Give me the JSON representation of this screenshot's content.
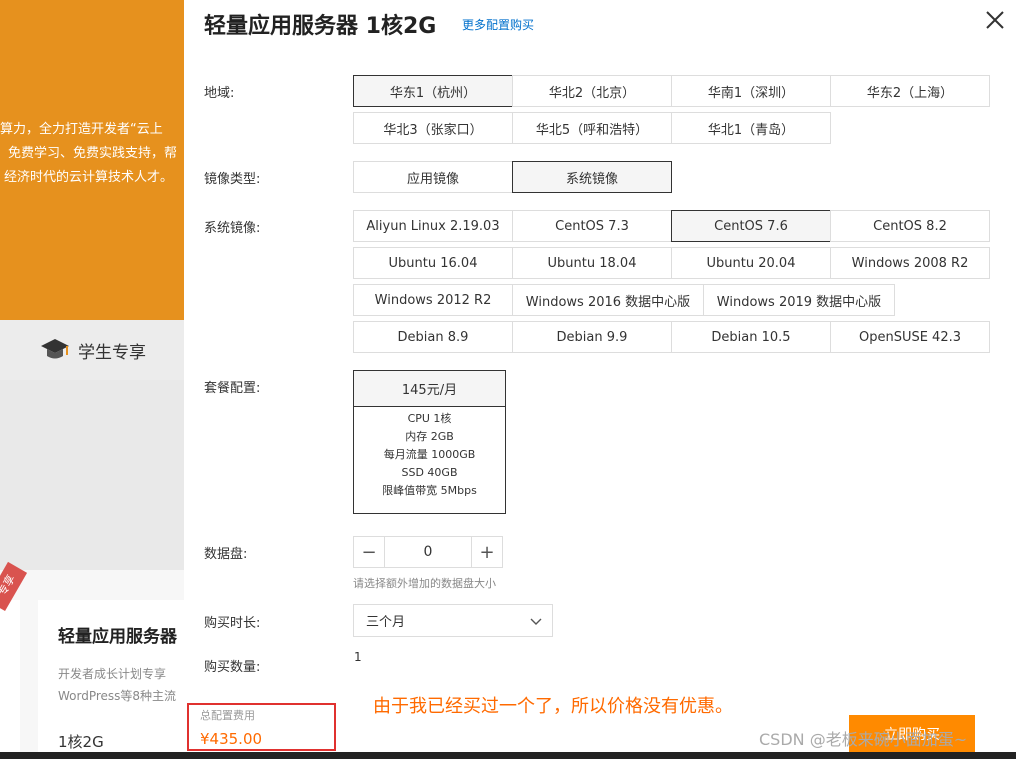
{
  "background": {
    "hero_lines": [
      "算力，全力打造开发者“云上",
      "免费学习、免费实践支持，帮",
      "经济时代的云计算技术人才。"
    ],
    "student_tab": "学生专享",
    "card": {
      "ribbon": "专享",
      "title": "轻量应用服务器",
      "line1": "开发者成长计划专享",
      "line2": "WordPress等8种主流",
      "spec": "1核2G"
    }
  },
  "drawer": {
    "title": "轻量应用服务器 1核2G",
    "more_link": "更多配置购买",
    "labels": {
      "region": "地域:",
      "image_type": "镜像类型:",
      "system_image": "系统镜像:",
      "package": "套餐配置:",
      "data_disk": "数据盘:",
      "duration": "购买时长:",
      "quantity": "购买数量:"
    },
    "regions": [
      "华东1（杭州）",
      "华北2（北京）",
      "华南1（深圳）",
      "华东2（上海）",
      "华北3（张家口）",
      "华北5（呼和浩特）",
      "华北1（青岛）"
    ],
    "selected_region": "华东1（杭州）",
    "image_types": [
      "应用镜像",
      "系统镜像"
    ],
    "selected_image_type": "系统镜像",
    "system_images": [
      "Aliyun Linux 2.19.03",
      "CentOS 7.3",
      "CentOS 7.6",
      "CentOS 8.2",
      "Ubuntu 16.04",
      "Ubuntu 18.04",
      "Ubuntu 20.04",
      "Windows 2008 R2",
      "Windows 2012 R2",
      "Windows 2016 数据中心版",
      "Windows 2019 数据中心版",
      "Debian 8.9",
      "Debian 9.9",
      "Debian 10.5",
      "OpenSUSE 42.3"
    ],
    "selected_system_image": "CentOS 7.6",
    "package": {
      "price": "145元/月",
      "specs": [
        "CPU 1核",
        "内存 2GB",
        "每月流量 1000GB",
        "SSD 40GB",
        "限峰值带宽 5Mbps"
      ]
    },
    "data_disk": {
      "minus": "−",
      "value": "0",
      "plus": "+",
      "hint": "请选择额外增加的数据盘大小"
    },
    "duration": "三个月",
    "quantity": "1",
    "cost": {
      "label": "总配置费用",
      "value": "¥435.00"
    },
    "note": "由于我已经买过一个了，所以价格没有优惠。",
    "buy_button": "立即购买",
    "watermark": "CSDN @老板来碗小面加蛋~"
  },
  "colors": {
    "accent": "#ff6a00",
    "hero": "#e6911e",
    "link": "#0070cc",
    "highlight_border": "#e0312f"
  }
}
